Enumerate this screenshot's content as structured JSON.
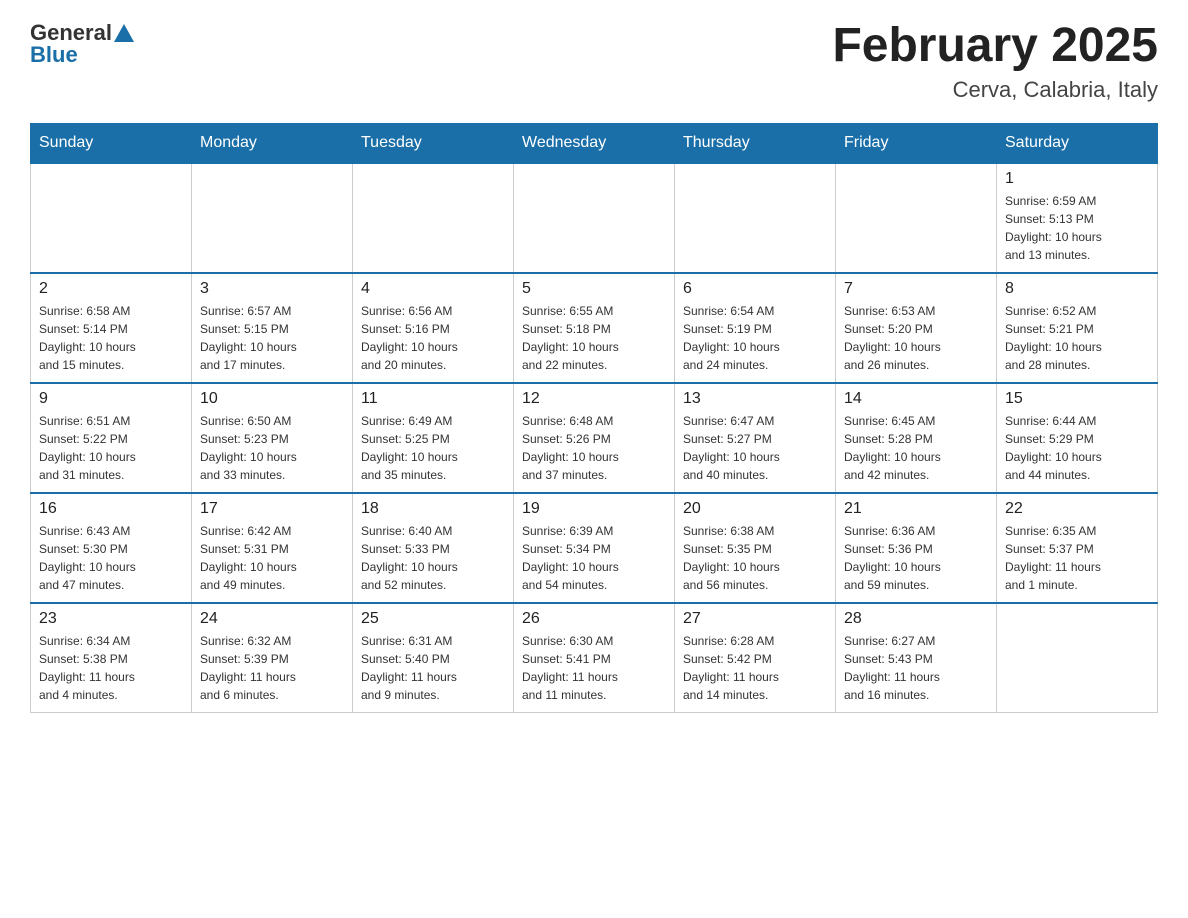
{
  "header": {
    "logo_general": "General",
    "logo_blue": "Blue",
    "title": "February 2025",
    "subtitle": "Cerva, Calabria, Italy"
  },
  "days_of_week": [
    "Sunday",
    "Monday",
    "Tuesday",
    "Wednesday",
    "Thursday",
    "Friday",
    "Saturday"
  ],
  "weeks": [
    {
      "days": [
        {
          "number": "",
          "info": ""
        },
        {
          "number": "",
          "info": ""
        },
        {
          "number": "",
          "info": ""
        },
        {
          "number": "",
          "info": ""
        },
        {
          "number": "",
          "info": ""
        },
        {
          "number": "",
          "info": ""
        },
        {
          "number": "1",
          "info": "Sunrise: 6:59 AM\nSunset: 5:13 PM\nDaylight: 10 hours\nand 13 minutes."
        }
      ]
    },
    {
      "days": [
        {
          "number": "2",
          "info": "Sunrise: 6:58 AM\nSunset: 5:14 PM\nDaylight: 10 hours\nand 15 minutes."
        },
        {
          "number": "3",
          "info": "Sunrise: 6:57 AM\nSunset: 5:15 PM\nDaylight: 10 hours\nand 17 minutes."
        },
        {
          "number": "4",
          "info": "Sunrise: 6:56 AM\nSunset: 5:16 PM\nDaylight: 10 hours\nand 20 minutes."
        },
        {
          "number": "5",
          "info": "Sunrise: 6:55 AM\nSunset: 5:18 PM\nDaylight: 10 hours\nand 22 minutes."
        },
        {
          "number": "6",
          "info": "Sunrise: 6:54 AM\nSunset: 5:19 PM\nDaylight: 10 hours\nand 24 minutes."
        },
        {
          "number": "7",
          "info": "Sunrise: 6:53 AM\nSunset: 5:20 PM\nDaylight: 10 hours\nand 26 minutes."
        },
        {
          "number": "8",
          "info": "Sunrise: 6:52 AM\nSunset: 5:21 PM\nDaylight: 10 hours\nand 28 minutes."
        }
      ]
    },
    {
      "days": [
        {
          "number": "9",
          "info": "Sunrise: 6:51 AM\nSunset: 5:22 PM\nDaylight: 10 hours\nand 31 minutes."
        },
        {
          "number": "10",
          "info": "Sunrise: 6:50 AM\nSunset: 5:23 PM\nDaylight: 10 hours\nand 33 minutes."
        },
        {
          "number": "11",
          "info": "Sunrise: 6:49 AM\nSunset: 5:25 PM\nDaylight: 10 hours\nand 35 minutes."
        },
        {
          "number": "12",
          "info": "Sunrise: 6:48 AM\nSunset: 5:26 PM\nDaylight: 10 hours\nand 37 minutes."
        },
        {
          "number": "13",
          "info": "Sunrise: 6:47 AM\nSunset: 5:27 PM\nDaylight: 10 hours\nand 40 minutes."
        },
        {
          "number": "14",
          "info": "Sunrise: 6:45 AM\nSunset: 5:28 PM\nDaylight: 10 hours\nand 42 minutes."
        },
        {
          "number": "15",
          "info": "Sunrise: 6:44 AM\nSunset: 5:29 PM\nDaylight: 10 hours\nand 44 minutes."
        }
      ]
    },
    {
      "days": [
        {
          "number": "16",
          "info": "Sunrise: 6:43 AM\nSunset: 5:30 PM\nDaylight: 10 hours\nand 47 minutes."
        },
        {
          "number": "17",
          "info": "Sunrise: 6:42 AM\nSunset: 5:31 PM\nDaylight: 10 hours\nand 49 minutes."
        },
        {
          "number": "18",
          "info": "Sunrise: 6:40 AM\nSunset: 5:33 PM\nDaylight: 10 hours\nand 52 minutes."
        },
        {
          "number": "19",
          "info": "Sunrise: 6:39 AM\nSunset: 5:34 PM\nDaylight: 10 hours\nand 54 minutes."
        },
        {
          "number": "20",
          "info": "Sunrise: 6:38 AM\nSunset: 5:35 PM\nDaylight: 10 hours\nand 56 minutes."
        },
        {
          "number": "21",
          "info": "Sunrise: 6:36 AM\nSunset: 5:36 PM\nDaylight: 10 hours\nand 59 minutes."
        },
        {
          "number": "22",
          "info": "Sunrise: 6:35 AM\nSunset: 5:37 PM\nDaylight: 11 hours\nand 1 minute."
        }
      ]
    },
    {
      "days": [
        {
          "number": "23",
          "info": "Sunrise: 6:34 AM\nSunset: 5:38 PM\nDaylight: 11 hours\nand 4 minutes."
        },
        {
          "number": "24",
          "info": "Sunrise: 6:32 AM\nSunset: 5:39 PM\nDaylight: 11 hours\nand 6 minutes."
        },
        {
          "number": "25",
          "info": "Sunrise: 6:31 AM\nSunset: 5:40 PM\nDaylight: 11 hours\nand 9 minutes."
        },
        {
          "number": "26",
          "info": "Sunrise: 6:30 AM\nSunset: 5:41 PM\nDaylight: 11 hours\nand 11 minutes."
        },
        {
          "number": "27",
          "info": "Sunrise: 6:28 AM\nSunset: 5:42 PM\nDaylight: 11 hours\nand 14 minutes."
        },
        {
          "number": "28",
          "info": "Sunrise: 6:27 AM\nSunset: 5:43 PM\nDaylight: 11 hours\nand 16 minutes."
        },
        {
          "number": "",
          "info": ""
        }
      ]
    }
  ]
}
